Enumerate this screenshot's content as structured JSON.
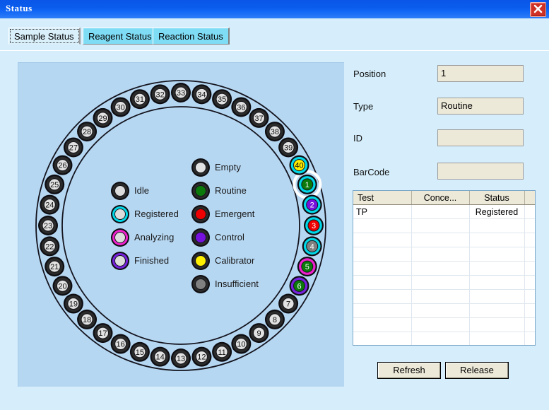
{
  "window": {
    "title": "Status",
    "close_icon": "close-icon",
    "close_label": "X"
  },
  "tabs": [
    {
      "id": "sample-status",
      "label": "Sample Status",
      "selected": true
    },
    {
      "id": "reagent-status",
      "label": "Reagent Status",
      "selected": false
    },
    {
      "id": "reaction-status",
      "label": "Reaction Status",
      "selected": false
    }
  ],
  "legend": {
    "status_column": [
      {
        "label": "Idle",
        "fill": "#dcdcdc",
        "ring": "#2b2b2b"
      },
      {
        "label": "Registered",
        "fill": "#dcdcdc",
        "ring": "#00d8e8"
      },
      {
        "label": "Analyzing",
        "fill": "#dcdcdc",
        "ring": "#ee22cc"
      },
      {
        "label": "Finished",
        "fill": "#dcdcdc",
        "ring": "#7722dd"
      }
    ],
    "type_column": [
      {
        "label": "Empty",
        "fill": "#e2e2e2",
        "ring": "#2b2b2b"
      },
      {
        "label": "Routine",
        "fill": "#0b7a0b",
        "ring": "#2b2b2b"
      },
      {
        "label": "Emergent",
        "fill": "#ee0000",
        "ring": "#2b2b2b"
      },
      {
        "label": "Control",
        "fill": "#7711dd",
        "ring": "#2b2b2b"
      },
      {
        "label": "Calibrator",
        "fill": "#ffef00",
        "ring": "#2b2b2b"
      },
      {
        "label": "Insufficient",
        "fill": "#808080",
        "ring": "#2b2b2b"
      }
    ]
  },
  "carousel": {
    "total_positions": 40,
    "selected_position": 1,
    "default_fill": "#e2e2e2",
    "default_ring": "#2b2b2b",
    "positions": [
      {
        "n": 1,
        "fill": "#0b7a0b",
        "ring": "#00d8e8",
        "selected": true
      },
      {
        "n": 2,
        "fill": "#7711dd",
        "ring": "#00d8e8"
      },
      {
        "n": 3,
        "fill": "#ee0000",
        "ring": "#00d8e8"
      },
      {
        "n": 4,
        "fill": "#808080",
        "ring": "#00d8e8"
      },
      {
        "n": 5,
        "fill": "#0b7a0b",
        "ring": "#ee22cc"
      },
      {
        "n": 6,
        "fill": "#0b7a0b",
        "ring": "#7722dd"
      },
      {
        "n": 7,
        "fill": "#e2e2e2",
        "ring": "#2b2b2b"
      },
      {
        "n": 8,
        "fill": "#e2e2e2",
        "ring": "#2b2b2b"
      },
      {
        "n": 9,
        "fill": "#e2e2e2",
        "ring": "#2b2b2b"
      },
      {
        "n": 10,
        "fill": "#e2e2e2",
        "ring": "#2b2b2b"
      },
      {
        "n": 11,
        "fill": "#e2e2e2",
        "ring": "#2b2b2b"
      },
      {
        "n": 12,
        "fill": "#e2e2e2",
        "ring": "#2b2b2b"
      },
      {
        "n": 13,
        "fill": "#e2e2e2",
        "ring": "#2b2b2b"
      },
      {
        "n": 14,
        "fill": "#e2e2e2",
        "ring": "#2b2b2b"
      },
      {
        "n": 15,
        "fill": "#e2e2e2",
        "ring": "#2b2b2b"
      },
      {
        "n": 16,
        "fill": "#e2e2e2",
        "ring": "#2b2b2b"
      },
      {
        "n": 17,
        "fill": "#e2e2e2",
        "ring": "#2b2b2b"
      },
      {
        "n": 18,
        "fill": "#e2e2e2",
        "ring": "#2b2b2b"
      },
      {
        "n": 19,
        "fill": "#e2e2e2",
        "ring": "#2b2b2b"
      },
      {
        "n": 20,
        "fill": "#e2e2e2",
        "ring": "#2b2b2b"
      },
      {
        "n": 21,
        "fill": "#e2e2e2",
        "ring": "#2b2b2b"
      },
      {
        "n": 22,
        "fill": "#e2e2e2",
        "ring": "#2b2b2b"
      },
      {
        "n": 23,
        "fill": "#e2e2e2",
        "ring": "#2b2b2b"
      },
      {
        "n": 24,
        "fill": "#e2e2e2",
        "ring": "#2b2b2b"
      },
      {
        "n": 25,
        "fill": "#e2e2e2",
        "ring": "#2b2b2b"
      },
      {
        "n": 26,
        "fill": "#e2e2e2",
        "ring": "#2b2b2b"
      },
      {
        "n": 27,
        "fill": "#e2e2e2",
        "ring": "#2b2b2b"
      },
      {
        "n": 28,
        "fill": "#e2e2e2",
        "ring": "#2b2b2b"
      },
      {
        "n": 29,
        "fill": "#e2e2e2",
        "ring": "#2b2b2b"
      },
      {
        "n": 30,
        "fill": "#e2e2e2",
        "ring": "#2b2b2b"
      },
      {
        "n": 31,
        "fill": "#e2e2e2",
        "ring": "#2b2b2b"
      },
      {
        "n": 32,
        "fill": "#e2e2e2",
        "ring": "#2b2b2b"
      },
      {
        "n": 33,
        "fill": "#e2e2e2",
        "ring": "#2b2b2b"
      },
      {
        "n": 34,
        "fill": "#e2e2e2",
        "ring": "#2b2b2b"
      },
      {
        "n": 35,
        "fill": "#e2e2e2",
        "ring": "#2b2b2b"
      },
      {
        "n": 36,
        "fill": "#e2e2e2",
        "ring": "#2b2b2b"
      },
      {
        "n": 37,
        "fill": "#e2e2e2",
        "ring": "#2b2b2b"
      },
      {
        "n": 38,
        "fill": "#e2e2e2",
        "ring": "#2b2b2b"
      },
      {
        "n": 39,
        "fill": "#e2e2e2",
        "ring": "#2b2b2b"
      },
      {
        "n": 40,
        "fill": "#ffef00",
        "ring": "#00d8e8"
      }
    ]
  },
  "details": {
    "position": {
      "label": "Position",
      "value": "1",
      "placeholder": ""
    },
    "type": {
      "label": "Type",
      "value": "Routine",
      "placeholder": ""
    },
    "id": {
      "label": "ID",
      "value": "",
      "placeholder": ""
    },
    "barcode": {
      "label": "BarCode",
      "value": "",
      "placeholder": ""
    }
  },
  "test_table": {
    "columns": [
      "Test",
      "Conce...",
      "Status",
      ""
    ],
    "rows": [
      [
        "TP",
        "",
        "Registered",
        ""
      ]
    ],
    "empty_row_count": 11
  },
  "buttons": {
    "refresh": "Refresh",
    "release": "Release"
  }
}
